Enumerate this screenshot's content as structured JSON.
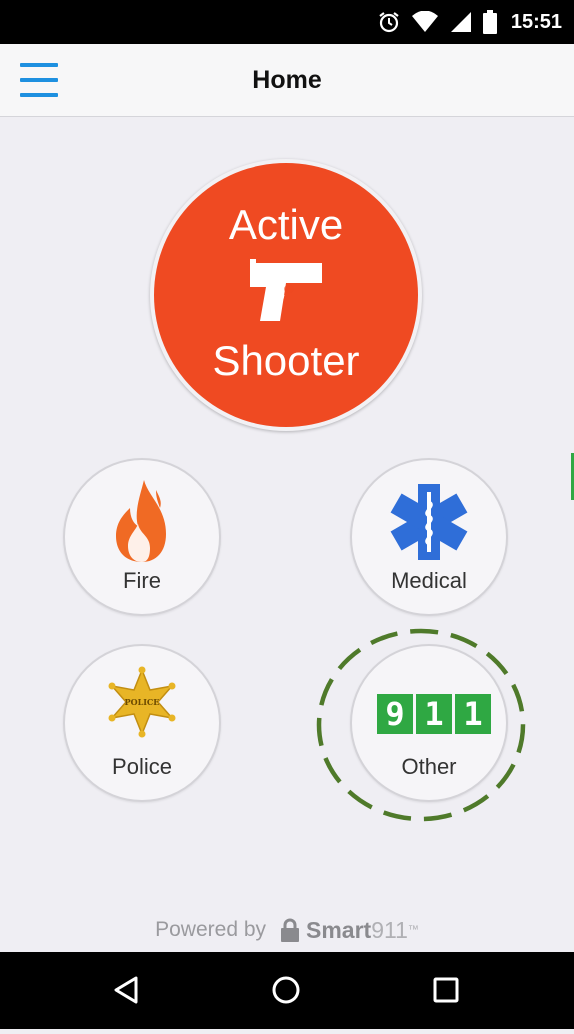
{
  "status_bar": {
    "time": "15:51",
    "icons": [
      "alarm-icon",
      "wifi-icon",
      "signal-icon",
      "battery-icon"
    ]
  },
  "app_bar": {
    "title": "Home",
    "menu_icon": "hamburger-menu-icon"
  },
  "main": {
    "active_shooter": {
      "line1": "Active",
      "line2": "Shooter",
      "icon": "pistol-icon",
      "color": "#ef4a22"
    },
    "buttons": [
      {
        "label": "Fire",
        "icon": "flame-icon"
      },
      {
        "label": "Medical",
        "icon": "star-of-life-icon"
      },
      {
        "label": "Police",
        "icon": "police-badge-icon",
        "icon_text": "POLICE"
      },
      {
        "label": "Other",
        "icon": "911-icon",
        "digits": [
          "9",
          "1",
          "1"
        ]
      }
    ]
  },
  "footer": {
    "powered_by": "Powered by",
    "brand_bold": "Smart",
    "brand_light": "911",
    "tm": "™"
  },
  "nav_bar": {
    "buttons": [
      "back-icon",
      "home-icon",
      "recents-icon"
    ]
  },
  "colors": {
    "accent_blue": "#1e90e0",
    "active_orange": "#ef4a22",
    "medical_blue": "#2f6ed8",
    "fire_orange": "#f06a24",
    "badge_gold": "#e8b526",
    "green_911": "#2fa843",
    "highlight_dash": "#4f7a2a"
  }
}
